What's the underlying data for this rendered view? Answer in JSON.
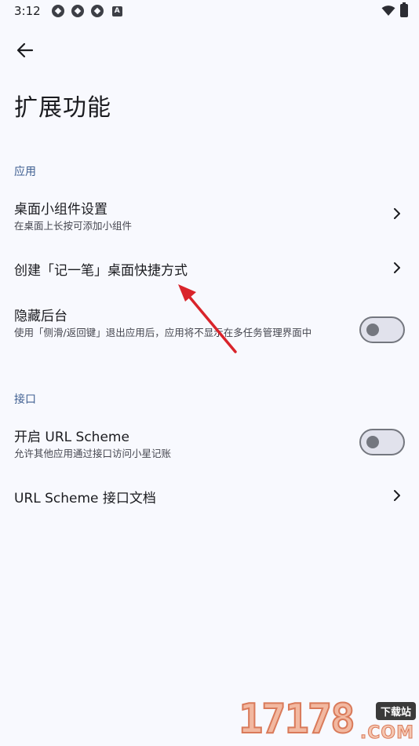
{
  "status_bar": {
    "time": "3:12",
    "notification_icon_letter": "A"
  },
  "header": {
    "title": "扩展功能"
  },
  "sections": {
    "app": {
      "label": "应用",
      "widget": {
        "title": "桌面小组件设置",
        "subtitle": "在桌面上长按可添加小组件"
      },
      "shortcut": {
        "title": "创建「记一笔」桌面快捷方式"
      },
      "hide_recents": {
        "title": "隐藏后台",
        "subtitle": "使用「侧滑/返回键」退出应用后，应用将不显示在多任务管理界面中",
        "enabled": false
      }
    },
    "api": {
      "label": "接口",
      "url_scheme": {
        "title": "开启 URL Scheme",
        "subtitle": "允许其他应用通过接口访问小星记账",
        "enabled": false
      },
      "docs": {
        "title": "URL Scheme 接口文档"
      }
    }
  },
  "watermark": {
    "number": "17178",
    "tag": "下载站",
    "domain": ".COM"
  },
  "colors": {
    "background": "#f8f9fe",
    "section_label": "#3f5f91",
    "annotation_arrow": "#d9242b"
  }
}
